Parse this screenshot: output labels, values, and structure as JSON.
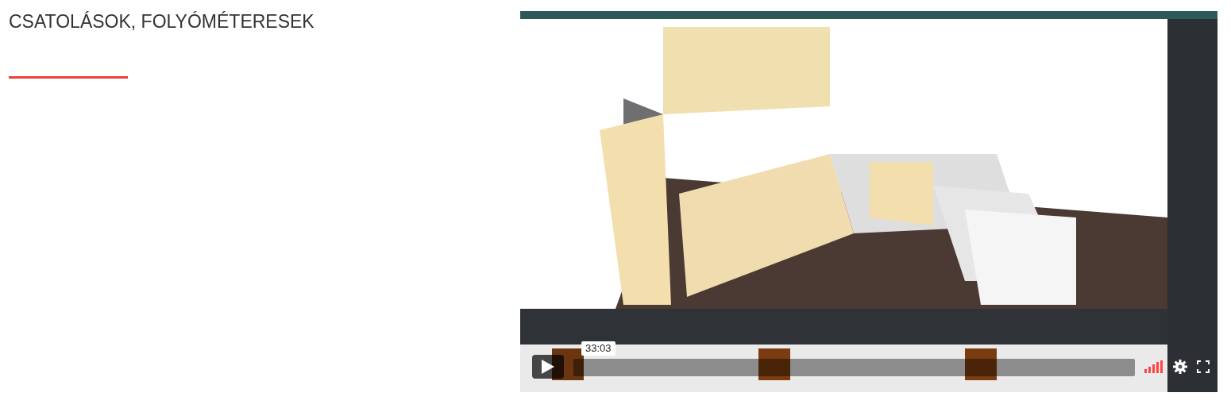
{
  "heading": "CSATOLÁSOK, FOLYÓMÉTERESEK",
  "video": {
    "time": "33:03"
  }
}
